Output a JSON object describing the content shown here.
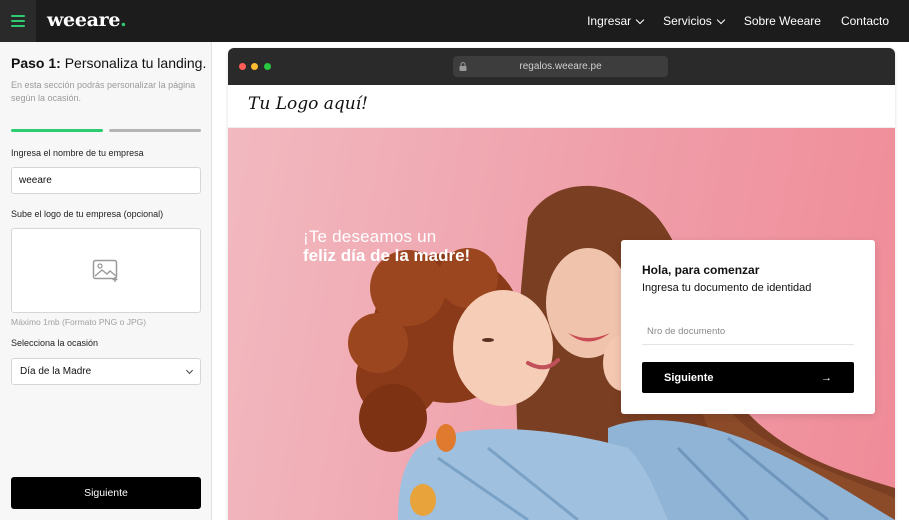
{
  "nav": {
    "brand": "weeare",
    "brand_dot": ".",
    "links": [
      {
        "label": "Ingresar"
      },
      {
        "label": "Servicios"
      },
      {
        "label": "Sobre Weeare"
      },
      {
        "label": "Contacto"
      }
    ]
  },
  "left": {
    "step_prefix": "Paso 1:",
    "step_title": "Personaliza tu landing.",
    "description": "En esta sección podrás personalizar la página según la ocasión.",
    "progress": {
      "current_step": 1,
      "total_steps": 2
    },
    "company_label": "Ingresa el nombre de tu empresa",
    "company_value": "weeare",
    "logo_label": "Sube el logo de tu empresa (opcional)",
    "logo_hint": "Máximo 1mb (Formato PNG o JPG)",
    "occasion_label": "Selecciona la ocasión",
    "occasion_value": "Día de la Madre",
    "next_label": "Siguiente"
  },
  "preview": {
    "url": "regalos.weeare.pe",
    "logo_text": "Tu Logo aquí!",
    "greeting_line1": "¡Te deseamos un",
    "greeting_line2": "feliz día de la madre!",
    "card": {
      "title": "Hola, para comenzar",
      "subtitle": "Ingresa tu documento de identidad",
      "placeholder": "Nro de documento",
      "button_label": "Siguiente",
      "button_arrow": "→"
    }
  },
  "colors": {
    "accent": "#2ecc71",
    "nav_bg": "#1c1c1c",
    "progress_inactive": "#b5b5b5",
    "traffic_red": "#ff5f57",
    "traffic_yellow": "#febc2e",
    "traffic_green": "#28c840",
    "hero_pink": "#ef9ea9"
  }
}
